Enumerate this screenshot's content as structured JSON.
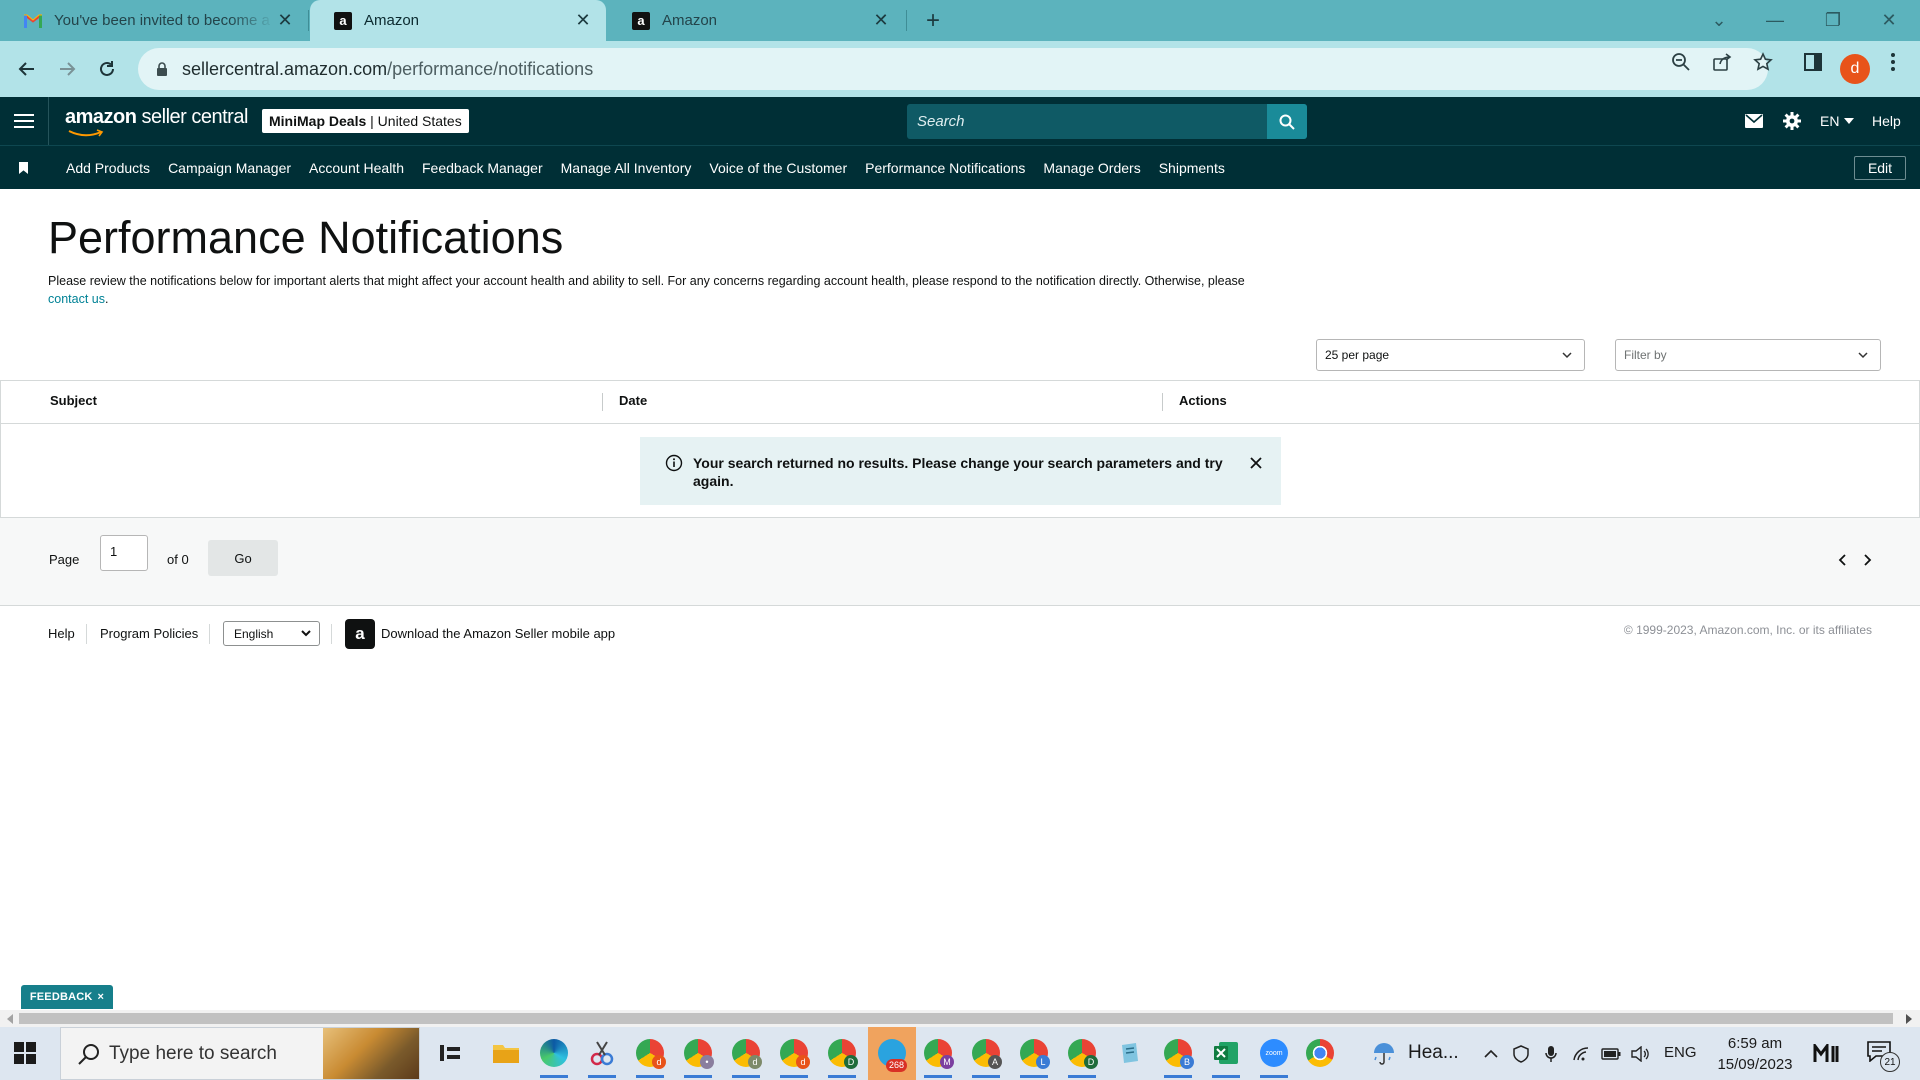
{
  "browser": {
    "tabs": [
      {
        "title": "You've been invited to become a",
        "icon": "gmail-icon"
      },
      {
        "title": "Amazon",
        "icon": "amazon-icon",
        "active": true
      },
      {
        "title": "Amazon",
        "icon": "amazon-icon"
      }
    ],
    "url_domain": "sellercentral.amazon.com",
    "url_path": "/performance/notifications",
    "profile_initial": "d"
  },
  "header": {
    "logo_amazon": "amazon",
    "logo_suffix": " seller central",
    "store_name": "MiniMap Deals",
    "store_sep": " | ",
    "store_region": "United States",
    "search_placeholder": "Search",
    "language": "EN",
    "help": "Help"
  },
  "nav": {
    "links": [
      "Add Products",
      "Campaign Manager",
      "Account Health",
      "Feedback Manager",
      "Manage All Inventory",
      "Voice of the Customer",
      "Performance Notifications",
      "Manage Orders",
      "Shipments"
    ],
    "edit": "Edit"
  },
  "page": {
    "title": "Performance Notifications",
    "description": "Please review the notifications below for important alerts that might affect your account health and ability to sell. For any concerns regarding account health, please respond to the notification directly. Otherwise, please ",
    "contact_link": "contact us",
    "description_end": ".",
    "per_page": "25 per page",
    "filter_placeholder": "Filter by"
  },
  "table": {
    "columns": [
      "Subject",
      "Date",
      "Actions"
    ],
    "empty_message": "Your search returned no results. Please change your search parameters and try again."
  },
  "pager": {
    "page_label": "Page",
    "page_value": "1",
    "of_label": "of 0",
    "go": "Go"
  },
  "footer": {
    "help": "Help",
    "policies": "Program Policies",
    "language": "English",
    "app_text": "Download the Amazon Seller mobile app",
    "copyright": "© 1999-2023, Amazon.com, Inc. or its affiliates"
  },
  "feedback": {
    "label": "FEEDBACK",
    "close": "×"
  },
  "taskbar": {
    "search_placeholder": "Type here to search",
    "telegram_badge": "268",
    "weather": "Hea...",
    "lang": "ENG",
    "time": "6:59 am",
    "date": "15/09/2023",
    "notifications": "21"
  },
  "colors": {
    "accent": "#008296",
    "header_bg": "#002f36",
    "tab_strip": "#5cb3bd",
    "profile": "#e8531a"
  }
}
